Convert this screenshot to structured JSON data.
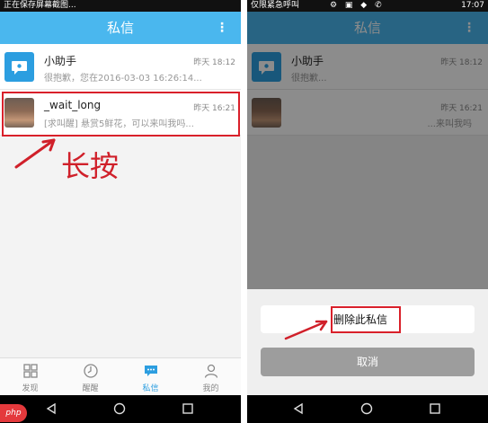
{
  "left": {
    "status": {
      "text": "正在保存屏幕截图...",
      "time": ""
    },
    "title": "私信",
    "more": "⋮",
    "items": [
      {
        "name": "小助手",
        "time": "昨天 18:12",
        "preview": "很抱歉，您在2016-03-03 16:26:14..."
      },
      {
        "name": "_wait_long",
        "time": "昨天 16:21",
        "preview": "[求叫醒] 悬赏5鲜花，可以来叫我吗..."
      }
    ],
    "annotation": "长按",
    "tabs": [
      {
        "label": "发现",
        "icon": "grid-icon"
      },
      {
        "label": "醒醒",
        "icon": "clock-icon"
      },
      {
        "label": "私信",
        "icon": "chat-icon"
      },
      {
        "label": "我的",
        "icon": "person-icon"
      }
    ]
  },
  "right": {
    "status": {
      "text": "仅限紧急呼叫",
      "time": "17:07"
    },
    "title": "私信",
    "more": "⋮",
    "items": [
      {
        "name": "小助手",
        "time": "昨天 18:12",
        "preview": "很抱歉..."
      },
      {
        "name": "",
        "time": "昨天 16:21",
        "preview": "...来叫我吗"
      }
    ],
    "sheet": {
      "delete_label": "删除此私信",
      "cancel_label": "取消"
    }
  },
  "logo_text": "php",
  "colors": {
    "accent": "#4ab7ee",
    "highlight": "#d9202a",
    "helper_avatar": "#2c9ee0"
  }
}
